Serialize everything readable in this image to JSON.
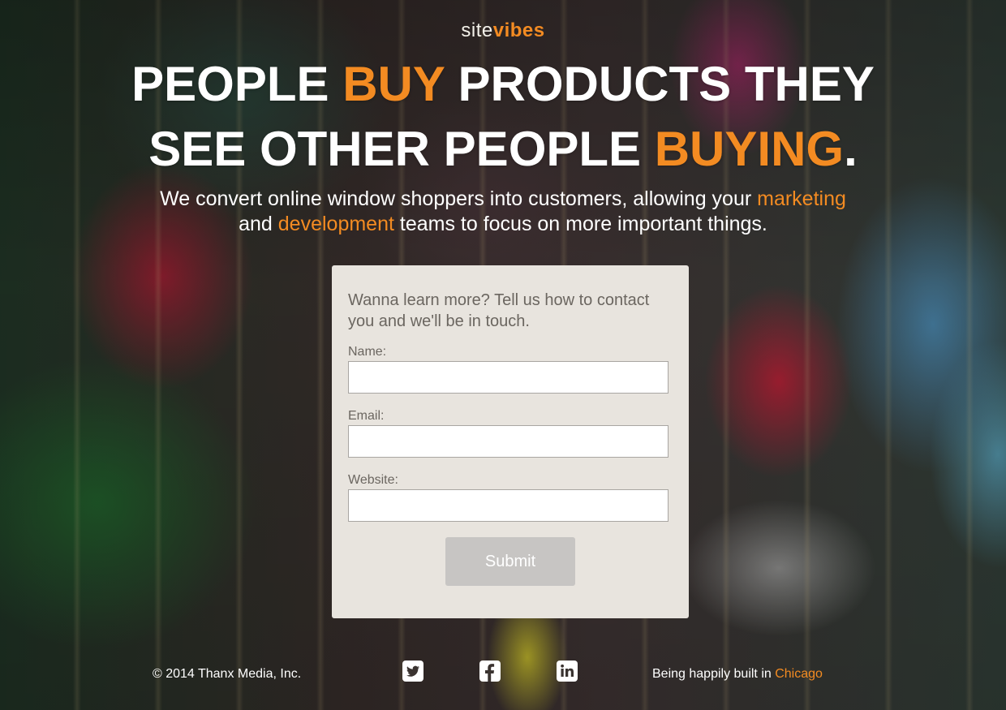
{
  "logo": {
    "site": "site",
    "vibes": "vibes"
  },
  "headline": {
    "line1_a": "PEOPLE ",
    "line1_b": "BUY",
    "line1_c": " PRODUCTS THEY",
    "line2_a": "SEE OTHER PEOPLE ",
    "line2_b": "BUYING",
    "line2_c": "."
  },
  "subhead": {
    "part1": "We convert online window shoppers into customers, allowing your ",
    "marketing": "marketing",
    "part2": "and ",
    "development": "development",
    "part3": " teams to focus on more important things."
  },
  "form": {
    "intro": "Wanna learn more? Tell us how to contact you and we'll be in touch.",
    "name_label": "Name:",
    "name_value": "",
    "email_label": "Email:",
    "email_value": "",
    "website_label": "Website:",
    "website_value": "",
    "submit_label": "Submit"
  },
  "footer": {
    "copyright": "© 2014 Thanx Media, Inc.",
    "built_prefix": "Being happily built in ",
    "built_city": "Chicago",
    "social": [
      "twitter-icon",
      "facebook-icon",
      "linkedin-icon"
    ]
  },
  "colors": {
    "accent": "#f38b22",
    "card": "#e8e4de",
    "button": "#c7c5c3"
  }
}
